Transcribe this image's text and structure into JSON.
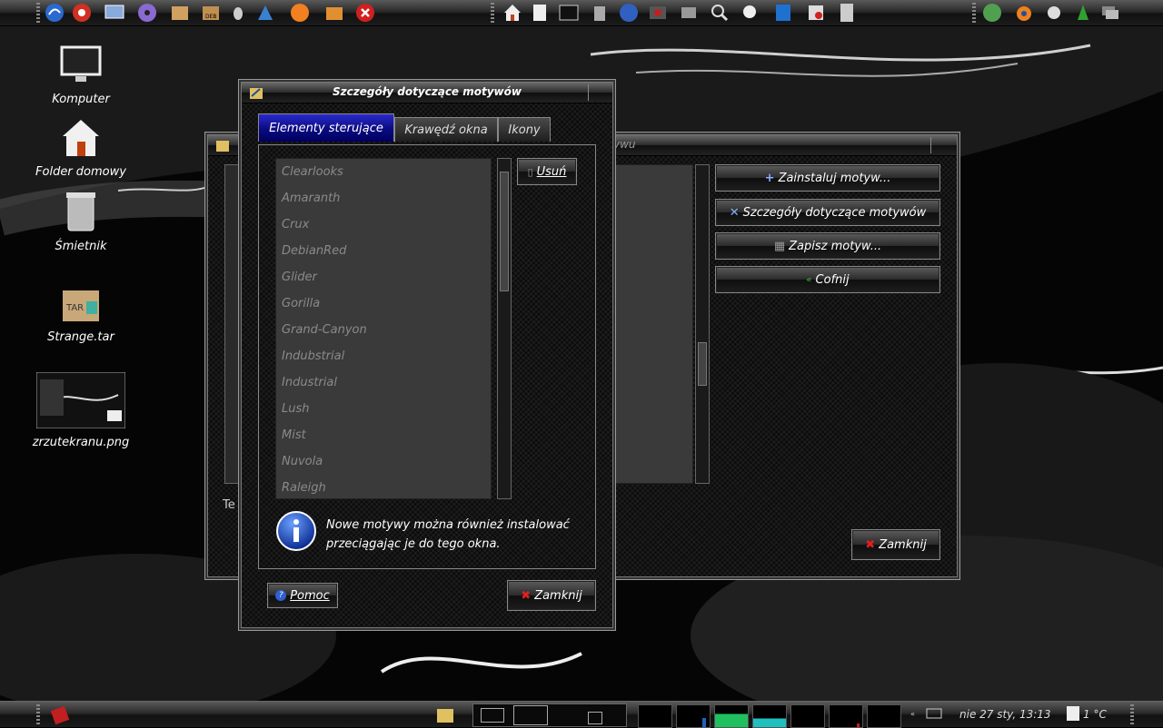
{
  "desktop": {
    "icons": [
      {
        "label": "Komputer",
        "icon": "monitor-icon"
      },
      {
        "label": "Folder domowy",
        "icon": "home-folder-icon"
      },
      {
        "label": "Śmietnik",
        "icon": "trash-icon"
      },
      {
        "label": "Strange.tar",
        "icon": "tar-archive-icon"
      },
      {
        "label": "zrzutekranu.png",
        "icon": "image-thumbnail-icon"
      }
    ]
  },
  "bg_window": {
    "title_fragment": "ywu",
    "buttons": {
      "install": "Zainstaluj motyw...",
      "details": "Szczegóły dotyczące motywów",
      "save": "Zapisz motyw...",
      "revert": "Cofnij",
      "close": "Zamknij"
    },
    "left_label": "Te"
  },
  "dialog": {
    "title": "Szczegóły dotyczące motywów",
    "tabs": [
      {
        "label": "Elementy sterujące",
        "active": true
      },
      {
        "label": "Krawędź okna",
        "active": false
      },
      {
        "label": "Ikony",
        "active": false
      }
    ],
    "themes": [
      "Clearlooks",
      "Amaranth",
      "Crux",
      "DebianRed",
      "Glider",
      "Gorilla",
      "Grand-Canyon",
      "Indubstrial",
      "Industrial",
      "Lush",
      "Mist",
      "Nuvola",
      "Raleigh"
    ],
    "remove_label": "Usuń",
    "info_text_line1": "Nowe motywy można również instalować",
    "info_text_line2": "przeciągając je do tego okna.",
    "help_label": "Pomoc",
    "close_label": "Zamknij"
  },
  "taskbar": {
    "clock": "nie 27 sty, 13:13",
    "temperature": "1 °C"
  },
  "colors": {
    "active_tab": "#1010a0",
    "list_bg": "#3a3a3a",
    "graph_green": "#20c060",
    "graph_cyan": "#20c0c0"
  }
}
